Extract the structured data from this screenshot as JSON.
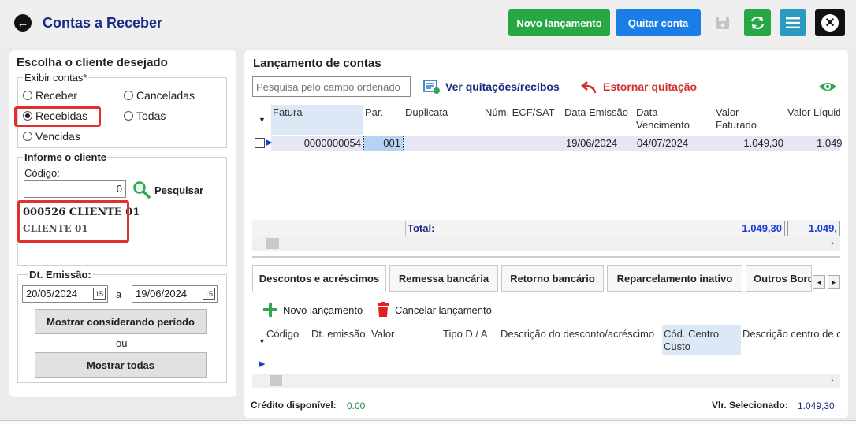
{
  "header": {
    "title": "Contas a Receber",
    "btn_novo": "Novo lançamento",
    "btn_quitar": "Quitar conta"
  },
  "left": {
    "heading": "Escolha o cliente desejado",
    "exibir_label": "Exibir contas*",
    "radios": {
      "receber": "Receber",
      "canceladas": "Canceladas",
      "recebidas": "Recebidas",
      "todas": "Todas",
      "vencidas": "Vencidas"
    },
    "informe_label": "Informe o cliente",
    "codigo_label": "Código:",
    "codigo_value": "0",
    "pesquisar": "Pesquisar",
    "cliente_line1": "000526 CLIENTE 01",
    "cliente_line2": "CLIENTE 01",
    "dt_label": "Dt. Emissão:",
    "date_from": "20/05/2024",
    "date_sep": "a",
    "date_to": "19/06/2024",
    "cal_icon": "15",
    "btn_periodo": "Mostrar considerando período",
    "ou": "ou",
    "btn_todas": "Mostrar todas"
  },
  "right": {
    "heading": "Lançamento de contas",
    "search_placeholder": "Pesquisa pelo campo ordenado",
    "ver_quitacoes": "Ver quitações/recibos",
    "estornar": "Estornar quitação",
    "columns": [
      "Fatura",
      "Par.",
      "Duplicata",
      "Núm. ECF/SAT",
      "Data Emissão",
      "Data Vencimento",
      "Valor Faturado",
      "Valor Líquido"
    ],
    "row": {
      "fatura": "0000000054",
      "par": "001",
      "duplicata": "",
      "ecf": "",
      "emissao": "19/06/2024",
      "vencimento": "04/07/2024",
      "faturado": "1.049,30",
      "liquido": "1.049"
    },
    "total_label": "Total:",
    "total_faturado": "1.049,30",
    "total_liquido": "1.049,"
  },
  "tabs": [
    "Descontos e acréscimos",
    "Remessa bancária",
    "Retorno bancário",
    "Reparcelamento inativo",
    "Outros Bord"
  ],
  "sub": {
    "novo": "Novo lançamento",
    "cancelar": "Cancelar lançamento",
    "columns": [
      "Código",
      "Dt. emissão",
      "Valor",
      "Tipo D / A",
      "Descrição do desconto/acréscimo",
      "Cód. Centro Custo",
      "Descrição centro de c"
    ]
  },
  "footer": {
    "credito_label": "Crédito disponível:",
    "credito_value": "0.00",
    "vlr_label": "Vlr. Selecionado:",
    "vlr_value": "1.049,30"
  },
  "colors": {
    "green": "#28a745",
    "blue": "#1a7ee6",
    "teal": "#2a9bbf",
    "red": "#e03030",
    "title_blue": "#1b2c86"
  }
}
